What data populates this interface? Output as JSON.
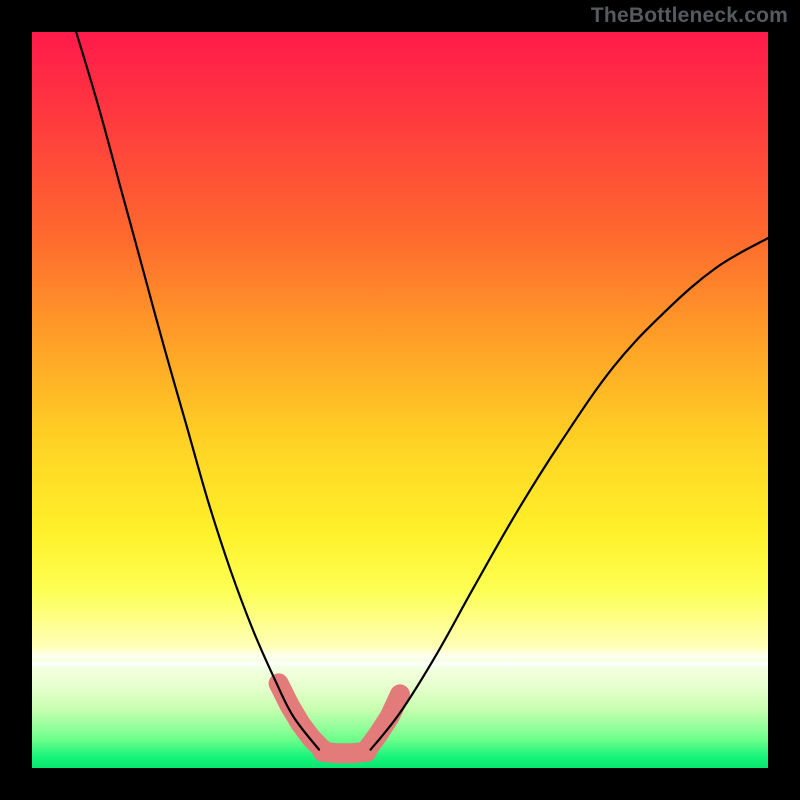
{
  "watermark": "TheBottleneck.com",
  "chart_data": {
    "type": "line",
    "title": "",
    "xlabel": "",
    "ylabel": "",
    "xlim": [
      0,
      1
    ],
    "ylim": [
      0,
      1
    ],
    "grid": false,
    "legend": false,
    "series": [
      {
        "name": "left-branch",
        "x": [
          0.06,
          0.09,
          0.12,
          0.15,
          0.18,
          0.21,
          0.24,
          0.27,
          0.3,
          0.33,
          0.355,
          0.39
        ],
        "y": [
          1.0,
          0.9,
          0.79,
          0.68,
          0.57,
          0.465,
          0.36,
          0.268,
          0.188,
          0.12,
          0.07,
          0.025
        ]
      },
      {
        "name": "right-branch",
        "x": [
          0.46,
          0.5,
          0.55,
          0.6,
          0.66,
          0.72,
          0.79,
          0.86,
          0.93,
          1.0
        ],
        "y": [
          0.025,
          0.075,
          0.155,
          0.245,
          0.35,
          0.445,
          0.545,
          0.62,
          0.68,
          0.72
        ]
      },
      {
        "name": "red-band-left-segment",
        "x": [
          0.335,
          0.35,
          0.365,
          0.38,
          0.395
        ],
        "y": [
          0.115,
          0.085,
          0.06,
          0.04,
          0.025
        ]
      },
      {
        "name": "red-band-bottom-segment",
        "x": [
          0.395,
          0.415,
          0.435,
          0.455
        ],
        "y": [
          0.022,
          0.02,
          0.02,
          0.022
        ]
      },
      {
        "name": "red-band-right-segment",
        "x": [
          0.455,
          0.47,
          0.486,
          0.5
        ],
        "y": [
          0.025,
          0.045,
          0.07,
          0.1
        ]
      }
    ],
    "colors": {
      "curve": "#000000",
      "band": "#E37B7B",
      "gradient_top": "#ff1a4b",
      "gradient_mid": "#fff12a",
      "gradient_bottom": "#07e66f"
    }
  }
}
